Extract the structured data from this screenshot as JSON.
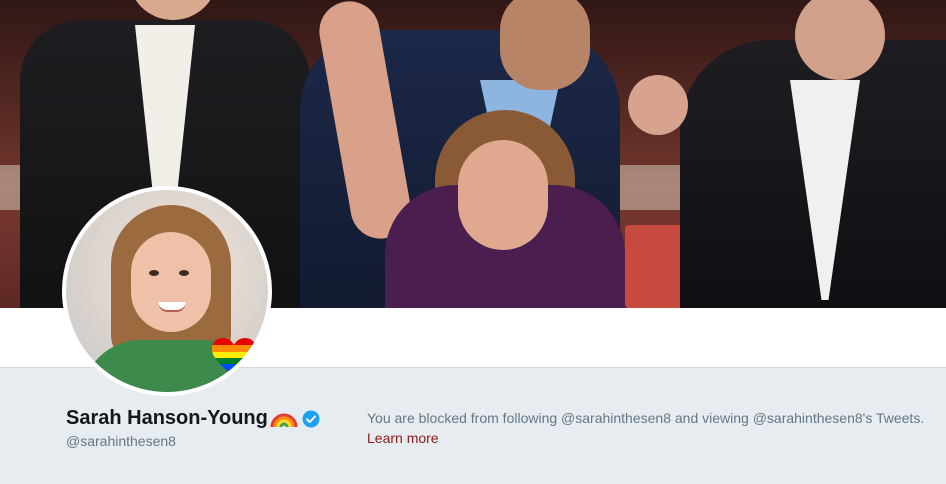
{
  "profile": {
    "name": "Sarah Hanson-Young",
    "name_emoji": "rainbow-icon",
    "verified": true,
    "handle": "@sarahinthesen8"
  },
  "blocked": {
    "message": "You are blocked from following @sarahinthesen8 and viewing @sarahinthesen8's Tweets.",
    "learn_more_label": "Learn more"
  },
  "colors": {
    "background": "#e6ecf0",
    "name_text": "#14171a",
    "secondary_text": "#657786",
    "link": "#8b1a1a",
    "verified_badge": "#1da1f2"
  },
  "icons": {
    "verified": "verified-badge-icon",
    "rainbow": "rainbow-icon",
    "avatar_badge": "rainbow-heart-icon"
  }
}
